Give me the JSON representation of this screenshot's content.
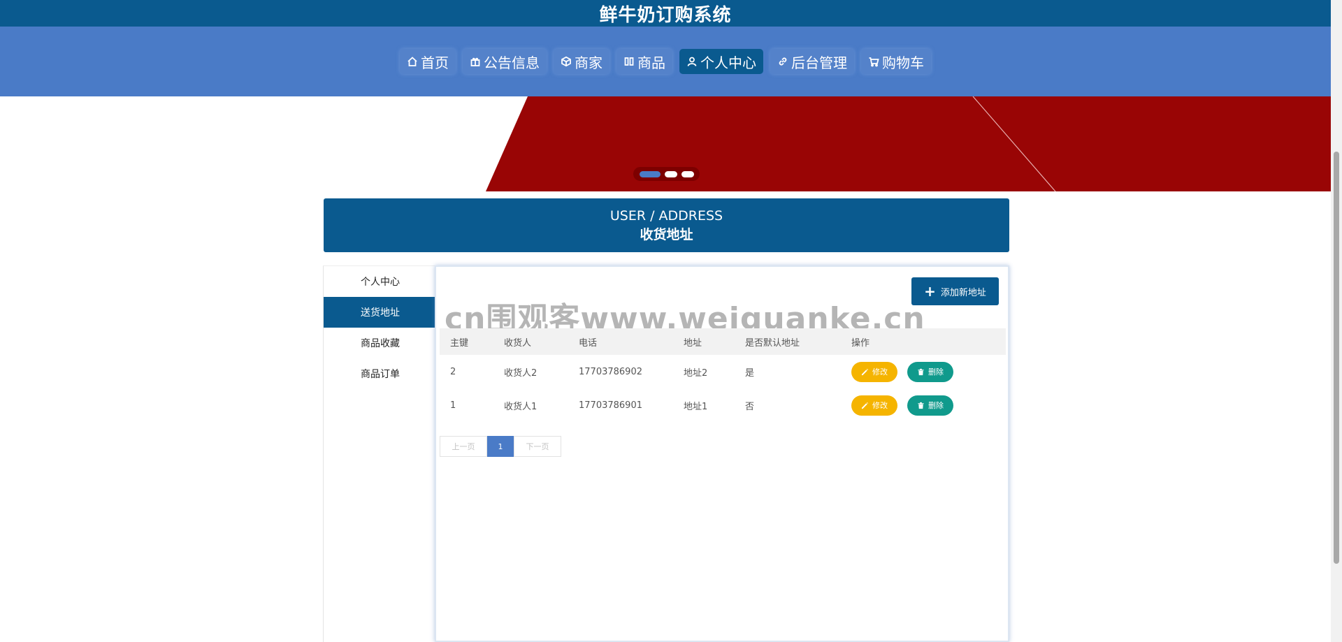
{
  "header": {
    "title": "鲜牛奶订购系统"
  },
  "nav": [
    {
      "label": "首页",
      "icon": "home-icon"
    },
    {
      "label": "公告信息",
      "icon": "gift-icon"
    },
    {
      "label": "商家",
      "icon": "cube-icon"
    },
    {
      "label": "商品",
      "icon": "columns-icon"
    },
    {
      "label": "个人中心",
      "icon": "user-icon",
      "active": true
    },
    {
      "label": "后台管理",
      "icon": "link-icon"
    },
    {
      "label": "购物车",
      "icon": "cart-icon"
    }
  ],
  "banner": {
    "active_slide": 1,
    "slide_count": 3,
    "color": "#990505"
  },
  "section": {
    "en": "USER / ADDRESS",
    "cn": "收货地址"
  },
  "side_menu": [
    {
      "label": "个人中心"
    },
    {
      "label": "送货地址",
      "active": true
    },
    {
      "label": "商品收藏"
    },
    {
      "label": "商品订单"
    }
  ],
  "toolbar": {
    "add_label": "添加新地址"
  },
  "watermark": "cn围观客www.weiguanke.cn",
  "table": {
    "columns": [
      "主键",
      "收货人",
      "电话",
      "地址",
      "是否默认地址",
      "操作"
    ],
    "rows": [
      {
        "id": "2",
        "name": "收货人2",
        "phone": "17703786902",
        "address": "地址2",
        "default": "是"
      },
      {
        "id": "1",
        "name": "收货人1",
        "phone": "17703786901",
        "address": "地址1",
        "default": "否"
      }
    ],
    "edit_label": "修改",
    "delete_label": "删除"
  },
  "pager": {
    "prev": "上一页",
    "current": "1",
    "next": "下一页"
  },
  "colors": {
    "primary": "#0a5a8f",
    "nav": "#4a7bc7",
    "edit": "#f5b400",
    "delete": "#109a8c"
  }
}
